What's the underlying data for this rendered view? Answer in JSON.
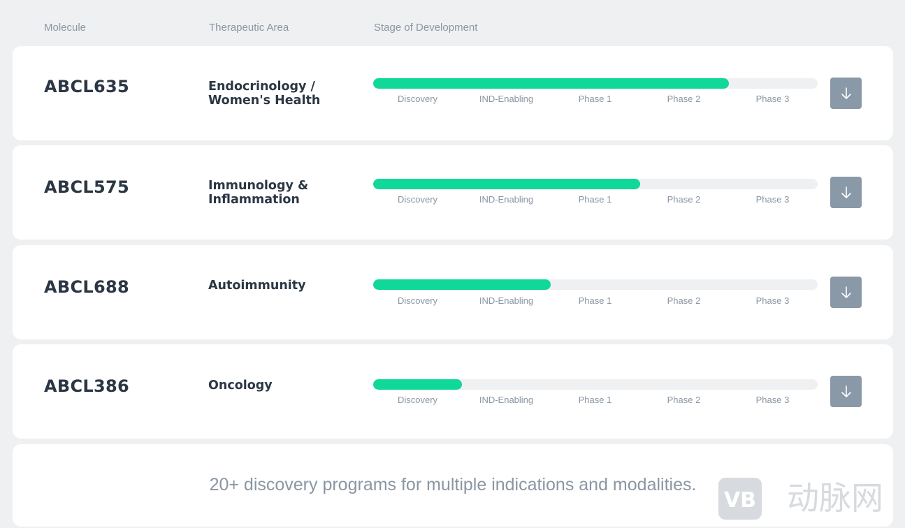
{
  "header": {
    "molecule": "Molecule",
    "area": "Therapeutic Area",
    "stage": "Stage of Development"
  },
  "stages": [
    "Discovery",
    "IND-Enabling",
    "Phase 1",
    "Phase 2",
    "Phase 3"
  ],
  "colors": {
    "progress": "#0fd898",
    "track": "#eff0f2",
    "button": "#8a99a7",
    "text": "#2b3744",
    "muted": "#8a96a3"
  },
  "rows": [
    {
      "molecule": "ABCL635",
      "area_line1": "Endocrinology /",
      "area_line2": "Women's Health",
      "progress_pct": 80,
      "icon": "arrow-down-icon"
    },
    {
      "molecule": "ABCL575",
      "area_line1": "Immunology &",
      "area_line2": "Inflammation",
      "progress_pct": 60,
      "icon": "arrow-down-icon"
    },
    {
      "molecule": "ABCL688",
      "area_line1": "Autoimmunity",
      "area_line2": "",
      "progress_pct": 40,
      "icon": "arrow-down-icon"
    },
    {
      "molecule": "ABCL386",
      "area_line1": "Oncology",
      "area_line2": "",
      "progress_pct": 20,
      "icon": "arrow-down-icon"
    }
  ],
  "footer": {
    "text": "20+ discovery programs for multiple indications and modalities."
  },
  "watermark": {
    "logo_text": "VB",
    "text": "动脉网"
  }
}
